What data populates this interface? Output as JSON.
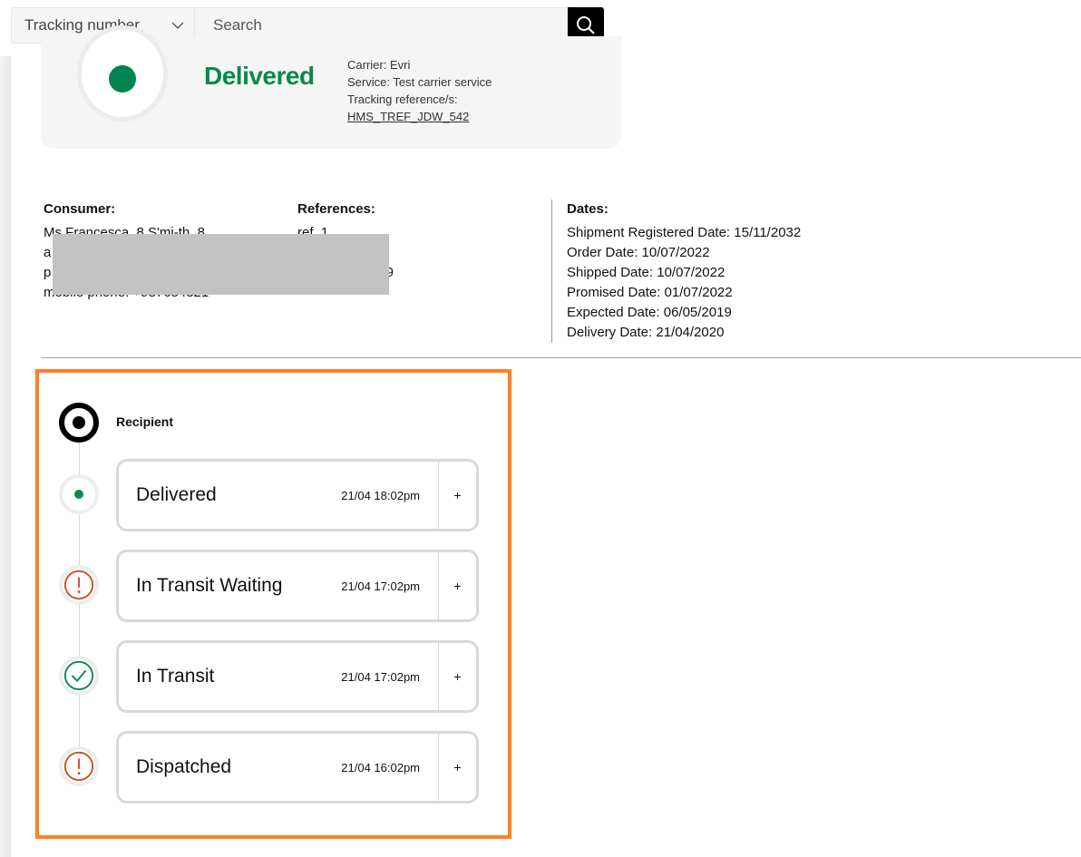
{
  "search": {
    "type_selected": "Tracking number",
    "placeholder": "Search",
    "value": ""
  },
  "summary": {
    "status": "Delivered",
    "carrier": "Carrier: Evri",
    "service": "Service: Test carrier service",
    "tracking_ref_label": "Tracking reference/s:",
    "tracking_ref": "HMS_TREF_JDW_542"
  },
  "details": {
    "consumer": {
      "heading": "Consumer:",
      "lines": [
        "Ms Francesca_8 S'mi-th_8",
        "a",
        "p",
        "mobile phone: +987654321"
      ]
    },
    "references": {
      "heading": "References:",
      "lines": [
        "ref_1",
        "",
        "9"
      ]
    },
    "dates": {
      "heading": "Dates:",
      "lines": [
        "Shipment Registered Date: 15/11/2032",
        "Order Date: 10/07/2022",
        "Shipped Date: 10/07/2022",
        "Promised Date: 01/07/2022",
        "Expected Date: 06/05/2019",
        "Delivery Date: 21/04/2020"
      ]
    }
  },
  "timeline": {
    "recipient_label": "Recipient",
    "events": [
      {
        "title": "Delivered",
        "time": "21/04 18:02pm",
        "status": "delivered",
        "expand": "+"
      },
      {
        "title": "In Transit Waiting",
        "time": "21/04 17:02pm",
        "status": "warning",
        "expand": "+"
      },
      {
        "title": "In Transit",
        "time": "21/04 17:02pm",
        "status": "success",
        "expand": "+"
      },
      {
        "title": "Dispatched",
        "time": "21/04 16:02pm",
        "status": "warning",
        "expand": "+"
      }
    ]
  },
  "colors": {
    "delivered_green": "#078a4c",
    "warning_orange": "#c8531c",
    "highlight": "#ff7f27"
  }
}
